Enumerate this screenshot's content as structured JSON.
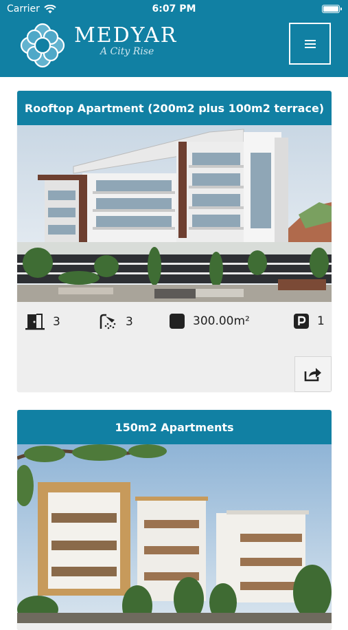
{
  "status_bar": {
    "carrier": "Carrier",
    "time": "6:07 PM"
  },
  "header": {
    "brand_name": "MEDYAR",
    "brand_tagline": "A City Rise",
    "menu_icon": "hamburger-menu-icon"
  },
  "listings": [
    {
      "title": "Rooftop Apartment (200m2 plus 100m2 terrace)",
      "bedrooms": "3",
      "bathrooms": "3",
      "area": "300.00m²",
      "parking": "1",
      "share_icon": "share-icon"
    },
    {
      "title": "150m2 Apartments"
    }
  ],
  "colors": {
    "brand_blue": "#1180a3",
    "card_bg": "#eeeeee"
  }
}
